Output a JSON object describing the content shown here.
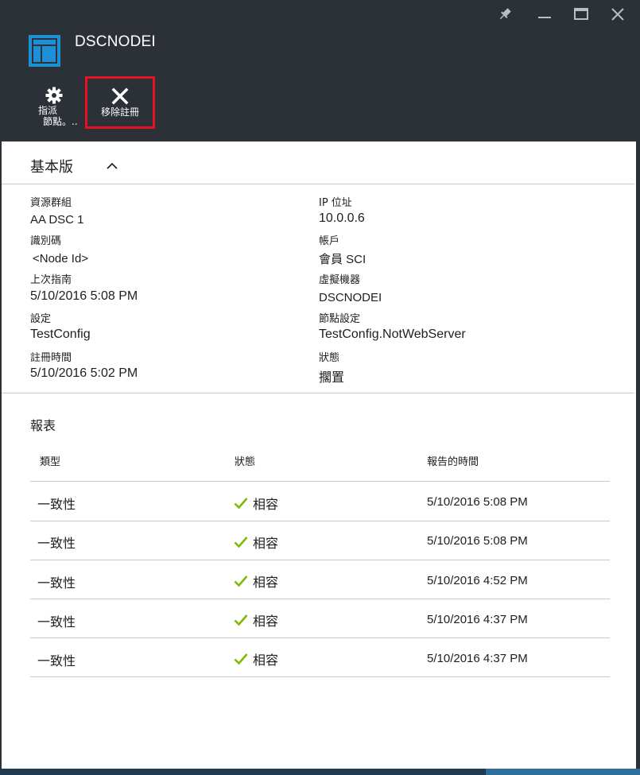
{
  "window": {
    "title": "DSCNODEI",
    "controls": [
      "pin-icon",
      "minimize-icon",
      "maximize-icon",
      "close-icon"
    ]
  },
  "toolbar": {
    "assign": {
      "icon": "gear-icon",
      "line1": "指派",
      "line2": "節點。.."
    },
    "unregister": {
      "icon": "x-icon",
      "label": "移除註冊",
      "highlight_color": "#e81123"
    }
  },
  "essentials": {
    "title": "基本版",
    "icon": "chevron-up-icon",
    "left": [
      {
        "label": "資源群組",
        "value": "AA DSC 1"
      },
      {
        "label": "識別碼",
        "value": "<Node Id>"
      },
      {
        "label": "上次指南",
        "value": "5/10/2016 5:08 PM"
      },
      {
        "label": "設定",
        "value": "TestConfig"
      },
      {
        "label": "註冊時間",
        "value": "5/10/2016 5:02 PM"
      }
    ],
    "right": [
      {
        "label": "IP 位址",
        "value": "10.0.0.6"
      },
      {
        "label": "帳戶",
        "value": "會員 SCI"
      },
      {
        "label": "虛擬機器",
        "value": "DSCNODEI"
      },
      {
        "label": "節點設定",
        "value": "TestConfig.NotWebServer"
      },
      {
        "label": "狀態",
        "value": "擱置"
      }
    ]
  },
  "reports": {
    "title": "報表",
    "columns": [
      "類型",
      "狀態",
      "報告的時間"
    ],
    "rows": [
      {
        "type": "一致性",
        "status": "相容",
        "time": "5/10/2016 5:08 PM"
      },
      {
        "type": "一致性",
        "status": "相容",
        "time": "5/10/2016 5:08 PM"
      },
      {
        "type": "一致性",
        "status": "相容",
        "time": "5/10/2016 4:52 PM"
      },
      {
        "type": "一致性",
        "status": "相容",
        "time": "5/10/2016 4:37 PM"
      },
      {
        "type": "一致性",
        "status": "相容",
        "time": "5/10/2016 4:37 PM"
      }
    ],
    "status_icon": "checkmark-icon",
    "status_color": "#7fba00"
  },
  "colors": {
    "header_bg": "#2b3137",
    "accent_blue": "#1e90d8"
  }
}
